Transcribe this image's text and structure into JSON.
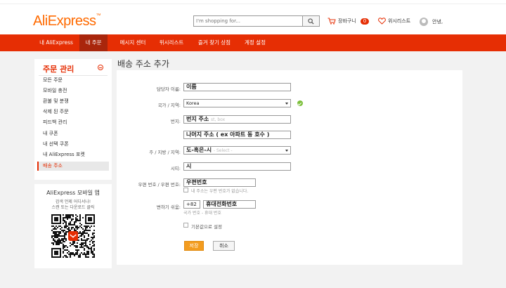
{
  "header": {
    "logo": "AliExpress",
    "logo_mark": "™",
    "search_placeholder": "I'm shopping for...",
    "cart_label": "장바구니",
    "cart_count": "0",
    "wishlist_label": "위시리스트",
    "greeting": "안녕,"
  },
  "nav": {
    "items": [
      {
        "label": "내 AliExpress"
      },
      {
        "label": "내 주문"
      },
      {
        "label": "메시지 센터"
      },
      {
        "label": "위시리스트"
      },
      {
        "label": "즐겨 찾기 상점"
      },
      {
        "label": "계정 설정"
      }
    ]
  },
  "sidebar": {
    "title": "주문 관리",
    "items": [
      {
        "label": "모든 주문"
      },
      {
        "label": "모바일 충전"
      },
      {
        "label": "환불 및 분쟁"
      },
      {
        "label": "삭제 된 주문"
      },
      {
        "label": "피드백 관리"
      },
      {
        "label": "내 쿠폰"
      },
      {
        "label": "내 선택 쿠폰"
      },
      {
        "label": "내 AliExpress 포켓"
      },
      {
        "label": "배송 주소"
      }
    ]
  },
  "app_promo": {
    "title": "AliExpress 모바일 앱",
    "line1": "검색 언제 어디서나!",
    "line2": "스캔 또는 다운로드 클릭"
  },
  "form": {
    "title": "배송 주소 추가",
    "contact_label": "담당자 이름:",
    "contact_value": "이름",
    "country_label": "국가 / 지역:",
    "country_value": "Korea",
    "street_label": "번지:",
    "street_value": "번지 주소",
    "street_ghost": "st, box",
    "street2_value": "나머지 주소 ( ex 아파트 동 호수 )",
    "province_label": "주 / 지방 / 지역:",
    "province_value": "도-혹은-시",
    "province_ghost": "- Select -",
    "city_label": "시티:",
    "city_value": "시",
    "zip_label": "우편 번호 / 우편 번호:",
    "zip_value": "우편번호",
    "no_zip_label": "내 주소는 우편 번호가 없습니다.",
    "phone_label": "변하기 쉬움:",
    "phone_code": "+82",
    "phone_value": "휴대전화번호",
    "phone_hint": "국가 번호 - 휴대 번호",
    "default_label": "기본값으로 설정",
    "save_label": "저장",
    "cancel_label": "취소"
  },
  "colors": {
    "brand": "#e62e04",
    "nav_active": "#a9260c",
    "save_button": "#f39c1f",
    "valid": "#7cbf3b"
  }
}
